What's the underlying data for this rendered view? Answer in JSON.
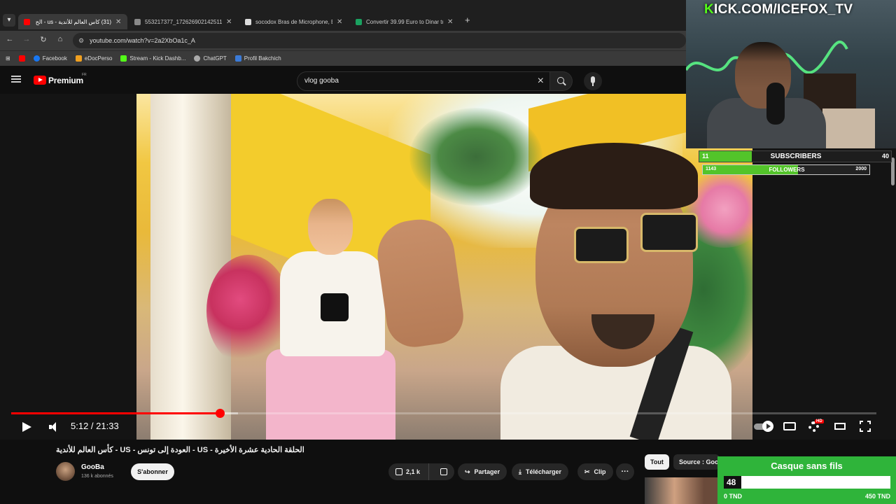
{
  "browser": {
    "tabs": [
      {
        "label": "(31) كأس العالم للأندية - us - الح",
        "icon_color": "#ff0000",
        "active": true
      },
      {
        "label": "553217377_1726269021425113",
        "icon_color": "#888888",
        "active": false
      },
      {
        "label": "socodox Bras de Microphone, B",
        "icon_color": "#dddddd",
        "active": false
      },
      {
        "label": "Convertir 39.99 Euro to Dinar tu",
        "icon_color": "#1aa260",
        "active": false
      }
    ],
    "new_tab_symbol": "+",
    "url": "youtube.com/watch?v=2a2XbOa1c_A",
    "bookmarks": [
      {
        "label": "",
        "icon_color": "#ff0000"
      },
      {
        "label": "Facebook",
        "icon_color": "#1877f2"
      },
      {
        "label": "eDocPerso",
        "icon_color": "#f0a020"
      },
      {
        "label": "Stream - Kick Dashb...",
        "icon_color": "#53fc18"
      },
      {
        "label": "ChatGPT",
        "icon_color": "#aaaaaa"
      },
      {
        "label": "Profil Bakchich",
        "icon_color": "#3b7bd8"
      }
    ]
  },
  "youtube": {
    "brand": "Premium",
    "brand_region": "FR",
    "search_query": "vlog gooba",
    "player": {
      "current_time": "5:12",
      "duration": "21:33",
      "time_display": "5:12 / 21:33",
      "played_fraction": 0.241,
      "buffered_fraction": 0.262,
      "settings_badge": "HD"
    },
    "video": {
      "title": "الحلقة الحادية عشرة الأخيرة - US - العودة إلى تونس - US - كأس العالم للأندية",
      "channel": "GooBa",
      "subscribers": "136 k abonnés",
      "subscribe_label": "S'abonner",
      "likes": "2,1 k",
      "share_label": "Partager",
      "download_label": "Télécharger",
      "clip_label": "Clip",
      "more_label": "···"
    },
    "chips": {
      "all": "Tout",
      "source": "Source : GooBa"
    }
  },
  "overlay": {
    "channel_prefix": "K",
    "channel_rest": "ICK.COM/ICEFOX_TV",
    "subscribers_goal": {
      "label": "SUBSCRIBERS",
      "current": "11",
      "target": "40",
      "fraction": 0.275
    },
    "followers_goal": {
      "label": "FOLLOWERS",
      "current": "1143",
      "target": "2000",
      "fraction": 0.5715
    },
    "donation_goal": {
      "title": "Casque sans fils",
      "current": "48",
      "min_label": "0 TND",
      "max_label": "450 TND",
      "fraction": 0.107
    }
  },
  "colors": {
    "youtube_red": "#ff0000",
    "kick_green": "#53fc18",
    "goal_green": "#53c42a",
    "donation_green": "#2fb43a"
  }
}
